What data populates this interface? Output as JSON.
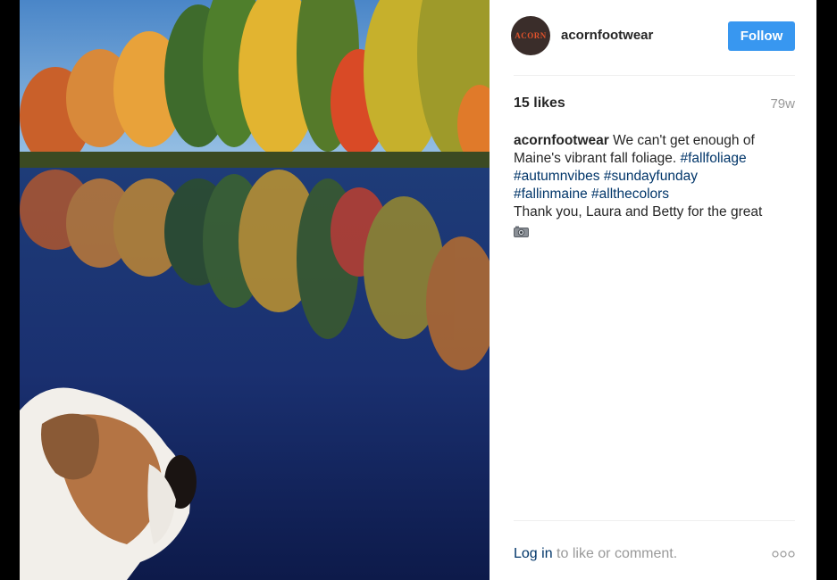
{
  "post": {
    "username": "acornfootwear",
    "avatar_text": "ACORN",
    "follow_label": "Follow",
    "likes": "15 likes",
    "age": "79w",
    "caption": {
      "user": "acornfootwear",
      "text_1": " We can't get enough of Maine's vibrant fall foliage. ",
      "tags_1": [
        "#fallfoliage",
        "#autumnvibes",
        "#sundayfunday",
        "#fallinmaine",
        "#allthecolors"
      ],
      "text_2": "Thank you, Laura and Betty for the great"
    },
    "login_link": "Log in",
    "login_text": " to like or comment.",
    "photo_icon": "photo-lake-foliage-dog",
    "camera_icon": "camera-icon",
    "more_icon": "more-options-icon",
    "colors": {
      "follow_bg": "#3897f0",
      "hashtag": "#003569",
      "muted": "#999999"
    }
  }
}
